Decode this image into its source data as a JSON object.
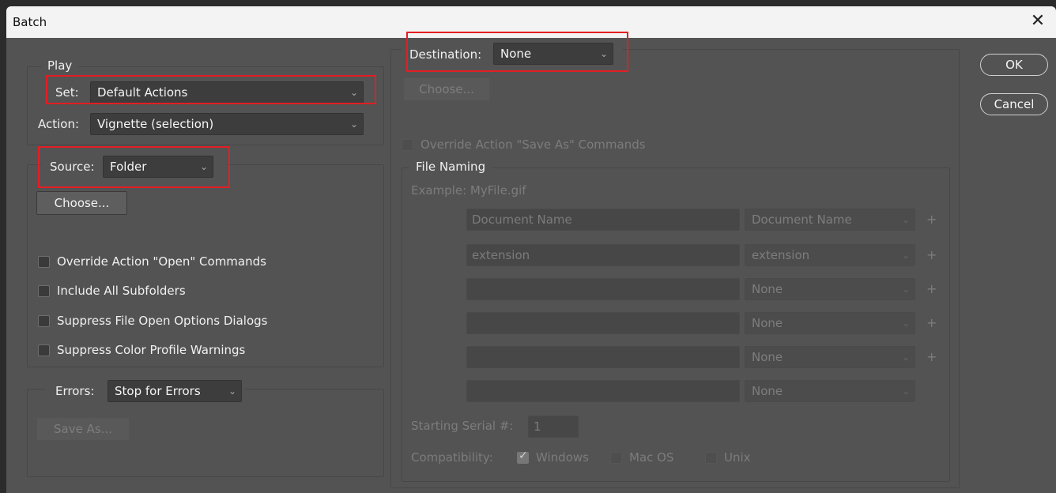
{
  "window": {
    "title": "Batch",
    "close_glyph": "✕"
  },
  "buttons": {
    "ok": "OK",
    "cancel": "Cancel"
  },
  "play": {
    "legend": "Play",
    "set_label": "Set:",
    "set_value": "Default Actions",
    "action_label": "Action:",
    "action_value": "Vignette (selection)"
  },
  "source": {
    "label": "Source:",
    "value": "Folder",
    "choose": "Choose...",
    "options": [
      {
        "label": "Override Action \"Open\" Commands",
        "checked": false
      },
      {
        "label": "Include All Subfolders",
        "checked": false
      },
      {
        "label": "Suppress File Open Options Dialogs",
        "checked": false
      },
      {
        "label": "Suppress Color Profile Warnings",
        "checked": false
      }
    ]
  },
  "errors": {
    "label": "Errors:",
    "value": "Stop for Errors",
    "save_as": "Save As..."
  },
  "destination": {
    "label": "Destination:",
    "value": "None",
    "choose": "Choose...",
    "override_label": "Override Action \"Save As\" Commands"
  },
  "file_naming": {
    "legend": "File Naming",
    "example": "Example: MyFile.gif",
    "rows": [
      {
        "text": "Document Name",
        "select": "Document Name",
        "plus": "+"
      },
      {
        "text": "extension",
        "select": "extension",
        "plus": "+"
      },
      {
        "text": "",
        "select": "None",
        "plus": "+"
      },
      {
        "text": "",
        "select": "None",
        "plus": "+"
      },
      {
        "text": "",
        "select": "None",
        "plus": "+"
      },
      {
        "text": "",
        "select": "None",
        "plus": ""
      }
    ],
    "serial_label": "Starting Serial #:",
    "serial_value": "1",
    "compat_label": "Compatibility:",
    "compat": [
      {
        "label": "Windows",
        "checked": true
      },
      {
        "label": "Mac OS",
        "checked": false
      },
      {
        "label": "Unix",
        "checked": false
      }
    ]
  },
  "colors": {
    "highlight": "#e31e24",
    "panel": "#535353",
    "field": "#3d3d3d"
  }
}
